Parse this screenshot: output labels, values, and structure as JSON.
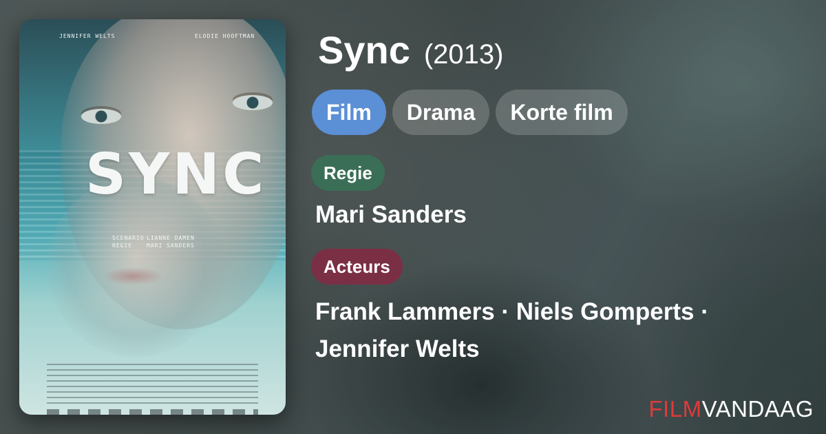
{
  "film": {
    "title": "Sync",
    "year": "(2013)"
  },
  "tags": [
    "Film",
    "Drama",
    "Korte film"
  ],
  "sections": {
    "director_label": "Regie",
    "director": "Mari Sanders",
    "actors_label": "Acteurs",
    "actors": "Frank Lammers · Niels Gomperts · Jennifer Welts"
  },
  "poster": {
    "title": "SYNC",
    "actor_left": "JENNIFER WELTS",
    "actor_right": "ELODIE HOOFTMAN",
    "credit_roles": "SCENARIO\nREGIE",
    "credit_names": "LIANNE DAMEN\nMARI SANDERS"
  },
  "brand": {
    "part1": "FILM",
    "part2": "VANDAAG"
  },
  "colors": {
    "tag_primary": "#5b8fd6",
    "regie_badge": "#3b6e56",
    "acteurs_badge": "#7a2f45",
    "brand_red": "#e03a3a"
  }
}
